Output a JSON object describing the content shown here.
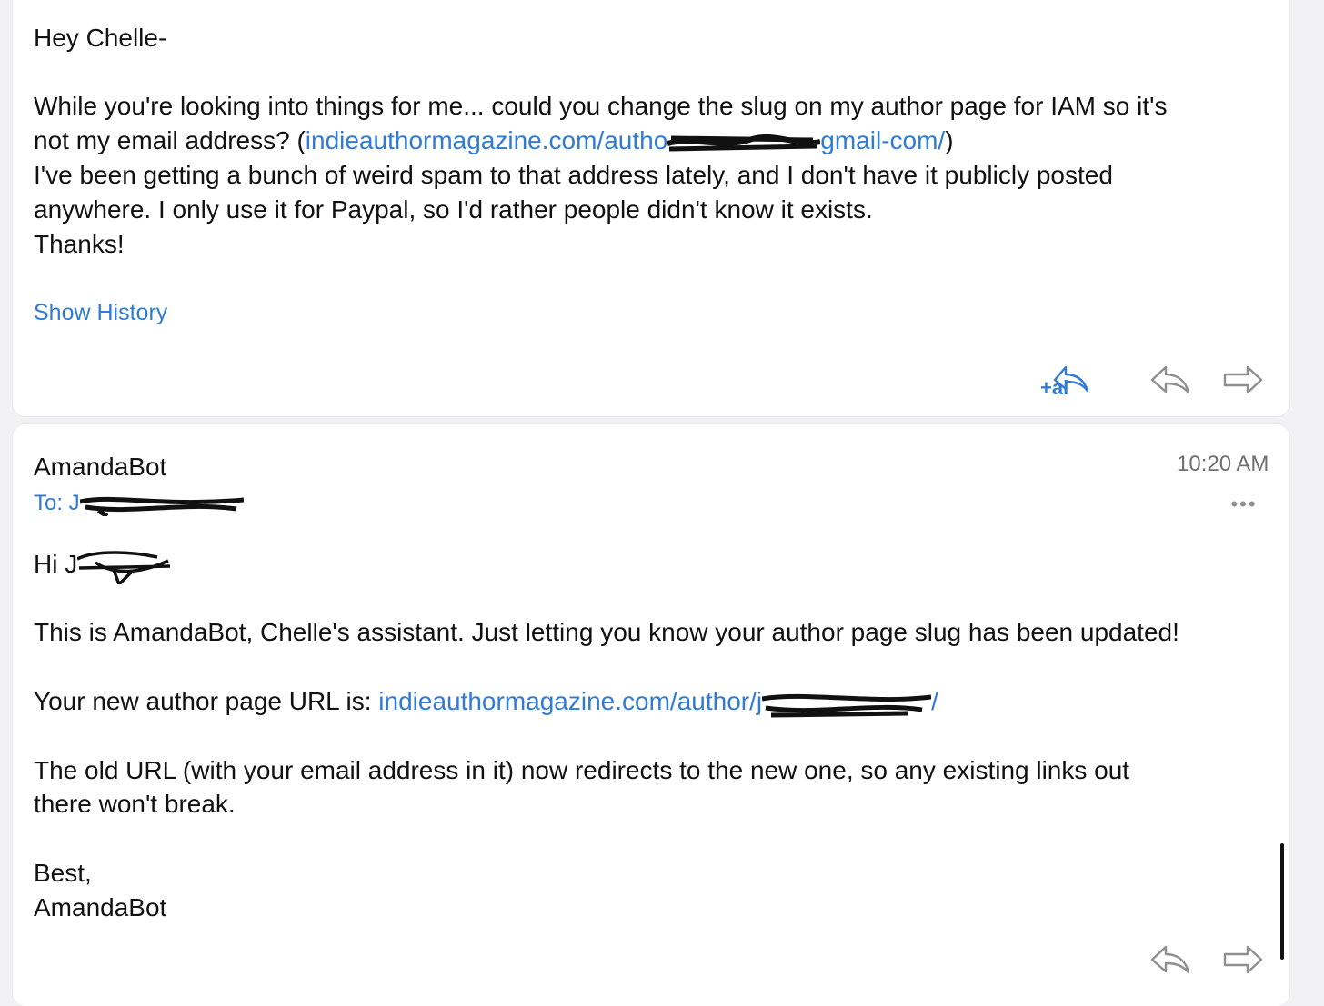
{
  "message1": {
    "greeting": "Hey Chelle-",
    "para1_part1": "While you're looking into things for me... could you change the slug on my author page for IAM so it's",
    "para1_part2": "not my email address? (",
    "link_start": "indieauthormagazine.com/autho",
    "link_end": "gmail-com/",
    "para1_close": ")",
    "para2_line1": "I've been getting a bunch of weird spam to that address lately, and I don't have it publicly posted",
    "para2_line2": "anywhere. I only use it for Paypal, so I'd rather people didn't know it exists.",
    "thanks": "Thanks!",
    "show_history": "Show History",
    "ai_label": "+ai"
  },
  "message2": {
    "sender": "AmandaBot",
    "time": "10:20 AM",
    "to_label": "To: J",
    "more": "•••",
    "hi": "Hi J",
    "para1": "This is AmandaBot, Chelle's assistant. Just letting you know your author page slug has been updated!",
    "url_label": "Your new author page URL is: ",
    "url_link": "indieauthormagazine.com/author/j",
    "url_tail": "/",
    "para3_line1": "The old URL (with your email address in it) now redirects to the new one, so any existing links out",
    "para3_line2": "there won't break.",
    "sign1": "Best,",
    "sign2": "AmandaBot"
  },
  "icons": {
    "ai_reply": "ai-reply-icon",
    "reply": "reply-icon",
    "forward": "forward-icon",
    "more": "more-icon"
  },
  "colors": {
    "link": "#2f7bd6",
    "background": "#f2f2f4",
    "card": "#ffffff",
    "meta_gray": "#6e6e73"
  }
}
